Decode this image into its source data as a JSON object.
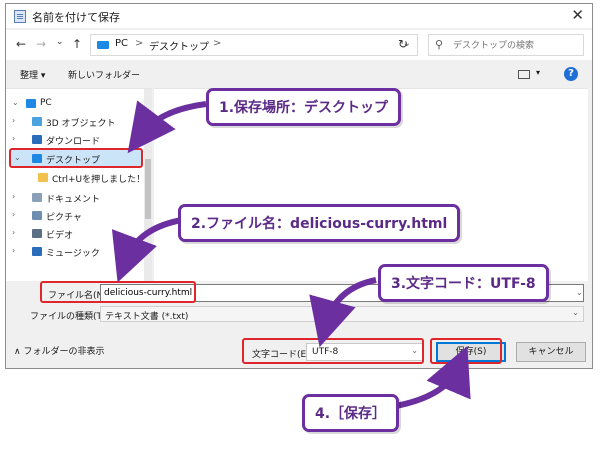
{
  "window": {
    "title": "名前を付けて保存",
    "close_glyph": "✕"
  },
  "nav": {
    "back_glyph": "←",
    "forward_glyph": "→",
    "recent_glyph": "⌄",
    "up_glyph": "↑",
    "breadcrumb": [
      "PC",
      ">",
      "デスクトップ",
      ">"
    ],
    "address_dropdown_glyph": "⌄",
    "refresh_glyph": "↻",
    "search_placeholder": "デスクトップの検索",
    "search_glyph": "⚲"
  },
  "toolbar": {
    "organize_label": "整理 ▾",
    "new_folder_label": "新しいフォルダー",
    "view_dropdown_glyph": "▾",
    "help_glyph": "?"
  },
  "tree": {
    "items": [
      {
        "label": "PC",
        "chevron": "⌄",
        "icon": "pc-icon",
        "color": "#1e88e5"
      },
      {
        "label": "3D オブジェクト",
        "chevron": "›",
        "icon": "3d-objects-icon",
        "color": "#4aa3df"
      },
      {
        "label": "ダウンロード",
        "chevron": "›",
        "icon": "download-icon",
        "color": "#2a6ebb"
      },
      {
        "label": "デスクトップ",
        "chevron": "⌄",
        "icon": "desktop-icon",
        "color": "#1e88e5",
        "selected": true
      },
      {
        "label": "Ctrl+Uを押しました！",
        "chevron": "",
        "icon": "folder-icon",
        "color": "#f2c14e"
      },
      {
        "label": "ドキュメント",
        "chevron": "›",
        "icon": "documents-icon",
        "color": "#8aa0b8"
      },
      {
        "label": "ピクチャ",
        "chevron": "›",
        "icon": "pictures-icon",
        "color": "#6f8fb0"
      },
      {
        "label": "ビデオ",
        "chevron": "›",
        "icon": "videos-icon",
        "color": "#5b6f85"
      },
      {
        "label": "ミュージック",
        "chevron": "›",
        "icon": "music-icon",
        "color": "#2a6ebb"
      }
    ]
  },
  "fields": {
    "filename_label": "ファイル名(N):",
    "filename_value": "delicious-curry.html",
    "filetype_label": "ファイルの種類(T):",
    "filetype_value": "テキスト文書 (*.txt)",
    "dropdown_glyph": "⌄"
  },
  "footer": {
    "hide_folders_label": "フォルダーの非表示",
    "hide_folders_glyph": "∧",
    "encoding_label": "文字コード(E):",
    "encoding_value": "UTF-8",
    "save_label": "保存(S)",
    "cancel_label": "キャンセル"
  },
  "annotations": {
    "step1": "1.保存場所：デスクトップ",
    "step2": "2.ファイル名：delicious-curry.html",
    "step3": "3.文字コード：UTF-8",
    "step4": "4.［保存］",
    "callout_color": "#6b2fa0",
    "highlight_color": "#e0262d"
  }
}
